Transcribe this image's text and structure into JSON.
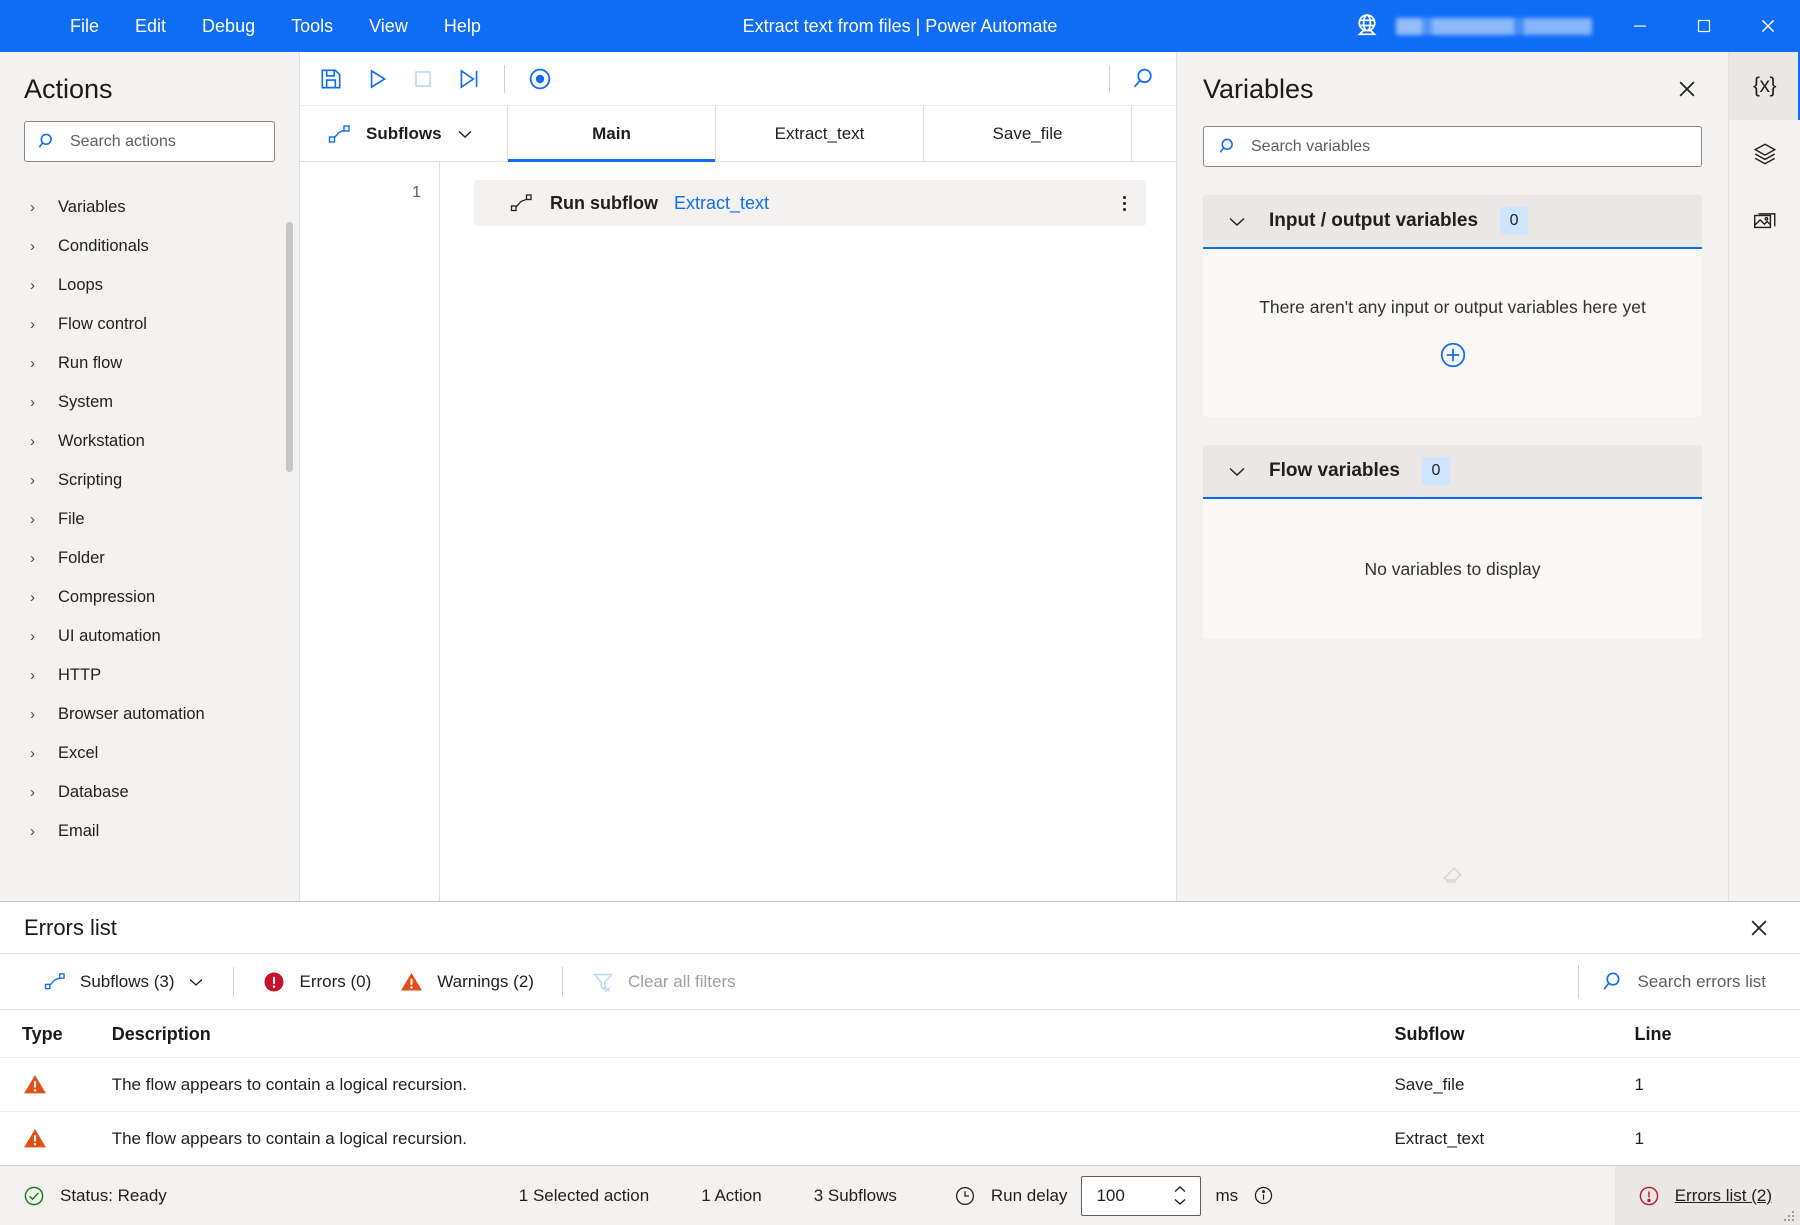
{
  "titlebar": {
    "menus": [
      "File",
      "Edit",
      "Debug",
      "Tools",
      "View",
      "Help"
    ],
    "title": "Extract text from files | Power Automate",
    "account_name_redacted": "",
    "globe_icon": "globe-icon",
    "minimize": "─",
    "maximize": "☐",
    "close": "✕"
  },
  "actions": {
    "heading": "Actions",
    "search_placeholder": "Search actions",
    "groups": [
      "Variables",
      "Conditionals",
      "Loops",
      "Flow control",
      "Run flow",
      "System",
      "Workstation",
      "Scripting",
      "File",
      "Folder",
      "Compression",
      "UI automation",
      "HTTP",
      "Browser automation",
      "Excel",
      "Database",
      "Email"
    ]
  },
  "toolbar": {
    "save": "save-icon",
    "run": "run-icon",
    "stop": "stop-icon",
    "run_next": "run-next-action-icon",
    "record": "record-icon",
    "search": "search-icon"
  },
  "tabs": {
    "subflows_label": "Subflows",
    "items": [
      {
        "label": "Main",
        "active": true
      },
      {
        "label": "Extract_text",
        "active": false
      },
      {
        "label": "Save_file",
        "active": false
      }
    ]
  },
  "canvas": {
    "line_number": "1",
    "action": {
      "icon": "subflow-icon",
      "label": "Run subflow",
      "argument": "Extract_text"
    }
  },
  "variables": {
    "heading": "Variables",
    "search_placeholder": "Search variables",
    "groups": [
      {
        "title": "Input / output variables",
        "count": "0",
        "empty_text": "There aren't any input or output variables here yet",
        "has_add": true
      },
      {
        "title": "Flow variables",
        "count": "0",
        "empty_text": "No variables to display",
        "has_add": false
      }
    ]
  },
  "rail": {
    "items": [
      {
        "icon": "variables-icon",
        "glyph": "{x}",
        "active": true
      },
      {
        "icon": "ui-elements-icon",
        "glyph": "",
        "active": false
      },
      {
        "icon": "images-icon",
        "glyph": "",
        "active": false
      }
    ]
  },
  "errors_panel": {
    "heading": "Errors list",
    "filters": {
      "subflows": "Subflows (3)",
      "errors": "Errors (0)",
      "warnings": "Warnings (2)",
      "clear_all": "Clear all filters"
    },
    "search_placeholder": "Search errors list",
    "columns": [
      "Type",
      "Description",
      "Subflow",
      "Line"
    ],
    "rows": [
      {
        "type": "warning",
        "description": "The flow appears to contain a logical recursion.",
        "subflow": "Save_file",
        "line": "1"
      },
      {
        "type": "warning",
        "description": "The flow appears to contain a logical recursion.",
        "subflow": "Extract_text",
        "line": "1"
      }
    ]
  },
  "statusbar": {
    "status": "Status: Ready",
    "selected_action": "1 Selected action",
    "action_count": "1 Action",
    "subflow_count": "3 Subflows",
    "run_delay_label": "Run delay",
    "run_delay_value": "100",
    "run_delay_unit": "ms",
    "errors_link": "Errors list (2)"
  },
  "colors": {
    "accent": "#0f6cf5",
    "warning": "#d83b01",
    "error": "#c4314b",
    "success": "#107c10",
    "chrome": "#f3f2f1"
  }
}
